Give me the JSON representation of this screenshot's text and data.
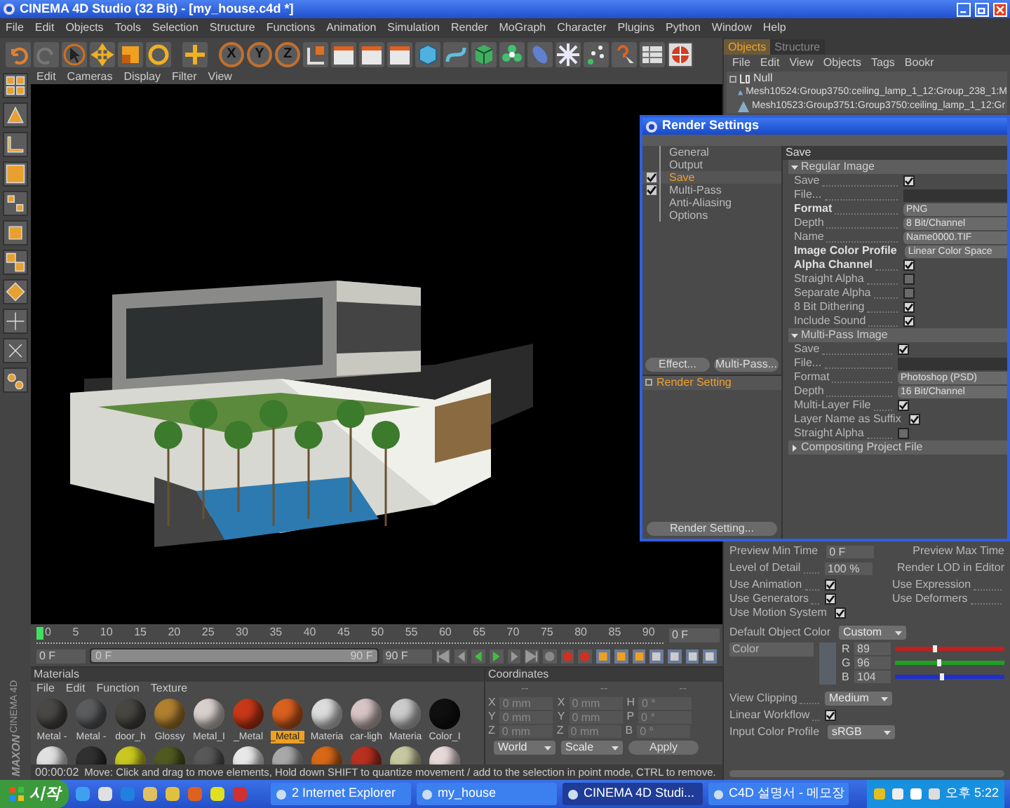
{
  "window": {
    "title": "CINEMA 4D Studio (32 Bit) - [my_house.c4d *]"
  },
  "menu": [
    "File",
    "Edit",
    "Objects",
    "Tools",
    "Selection",
    "Structure",
    "Functions",
    "Animation",
    "Simulation",
    "Render",
    "MoGraph",
    "Character",
    "Plugins",
    "Python",
    "Window",
    "Help"
  ],
  "axis_buttons": [
    "X",
    "Y",
    "Z"
  ],
  "logo": [
    "MAXON",
    "CINEMA 4D"
  ],
  "viewport": {
    "menu": [
      "Edit",
      "Cameras",
      "Display",
      "Filter",
      "View"
    ]
  },
  "timeline": {
    "ticks": [
      "0",
      "5",
      "10",
      "15",
      "20",
      "25",
      "30",
      "35",
      "40",
      "45",
      "50",
      "55",
      "60",
      "65",
      "70",
      "75",
      "80",
      "85",
      "90"
    ],
    "current_frame": "0 F",
    "start": "0 F",
    "range": {
      "start": "0 F",
      "end": "90 F",
      "level": 1
    },
    "end": "90 F"
  },
  "materials": {
    "title": "Materials",
    "menu": [
      "File",
      "Edit",
      "Function",
      "Texture"
    ],
    "items": [
      {
        "label": "Metal -",
        "color": "#4a4844",
        "selected": false
      },
      {
        "label": "Metal -",
        "color": "#5a5c5e",
        "selected": false
      },
      {
        "label": "door_h",
        "color": "#484640",
        "selected": false
      },
      {
        "label": "Glossy",
        "color": "#b08030",
        "selected": false
      },
      {
        "label": "Metal_I",
        "color": "#d8d0cc",
        "selected": false
      },
      {
        "label": "_Metal",
        "color": "#c83818",
        "selected": false
      },
      {
        "label": "_Metal_",
        "color": "#d86020",
        "selected": true
      },
      {
        "label": "Materia",
        "color": "#dcdcdc",
        "selected": false
      },
      {
        "label": "car-ligh",
        "color": "#d8c4c4",
        "selected": false
      },
      {
        "label": "Materia",
        "color": "#cccccc",
        "selected": false
      },
      {
        "label": "Color_I",
        "color": "#101010",
        "selected": false
      }
    ],
    "more_items": [
      {
        "color": "#e0e0e0"
      },
      {
        "color": "#303030"
      },
      {
        "color": "#c8c820"
      },
      {
        "color": "#505a20"
      },
      {
        "color": "#585858"
      },
      {
        "color": "#e8e8e8"
      },
      {
        "color": "#a8a8a8"
      },
      {
        "color": "#d86818"
      },
      {
        "color": "#b83020"
      },
      {
        "color": "#c8c8a0"
      },
      {
        "color": "#e8d8d8"
      }
    ]
  },
  "coordinates": {
    "title": "Coordinates",
    "headers": [
      "--",
      "--",
      "--"
    ],
    "rows": [
      {
        "axis": "X",
        "position": "0 mm",
        "size_axis": "X",
        "size": "0 mm",
        "rot_axis": "H",
        "rotation": "0 °"
      },
      {
        "axis": "Y",
        "position": "0 mm",
        "size_axis": "Y",
        "size": "0 mm",
        "rot_axis": "P",
        "rotation": "0 °"
      },
      {
        "axis": "Z",
        "position": "0 mm",
        "size_axis": "Z",
        "size": "0 mm",
        "rot_axis": "B",
        "rotation": "0 °"
      }
    ],
    "mode": "World",
    "size_mode": "Scale",
    "apply": "Apply"
  },
  "status_bar": {
    "time": "00:00:02",
    "message": "Move: Click and drag to move elements, Hold down SHIFT to quantize movement / add to the selection in point mode, CTRL to remove."
  },
  "objects_panel": {
    "tabs": [
      {
        "label": "Objects",
        "selected": true
      },
      {
        "label": "Structure",
        "selected": false
      }
    ],
    "menu": [
      "File",
      "Edit",
      "View",
      "Objects",
      "Tags",
      "Bookr"
    ],
    "tree": [
      {
        "label": "Null",
        "children": [
          {
            "label": "Mesh10524:Group3750:ceiling_lamp_1_12:Group_238_1:M"
          },
          {
            "label": "Mesh10523:Group3751:Group3750:ceiling_lamp_1_12:Gr"
          }
        ]
      }
    ]
  },
  "attributes": {
    "preview_min": {
      "label": "Preview Min Time",
      "value": "0 F"
    },
    "preview_max": {
      "label": "Preview Max Time"
    },
    "level_of_detail": {
      "label": "Level of Detail",
      "value": "100 %"
    },
    "render_lod": {
      "label": "Render LOD in Editor"
    },
    "left_checks": [
      {
        "label": "Use Animation",
        "checked": true
      },
      {
        "label": "Use Generators",
        "checked": true
      },
      {
        "label": "Use Motion System",
        "checked": true
      }
    ],
    "right_checks": [
      {
        "label": "Use Expression"
      },
      {
        "label": "Use Deformers"
      }
    ],
    "default_color": {
      "label": "Default Object Color",
      "value": "Custom"
    },
    "color": {
      "label": "Color",
      "color": "#596068",
      "channels": [
        {
          "name": "R",
          "value": "89",
          "level": 0.35,
          "color": "#c02020"
        },
        {
          "name": "G",
          "value": "96",
          "level": 0.38,
          "color": "#20a020"
        },
        {
          "name": "B",
          "value": "104",
          "level": 0.41,
          "color": "#2030c8"
        }
      ]
    },
    "view_clipping": {
      "label": "View Clipping",
      "value": "Medium"
    },
    "linear_workflow": {
      "label": "Linear Workflow",
      "checked": true
    },
    "input_profile": {
      "label": "Input Color Profile",
      "value": "sRGB"
    }
  },
  "render_settings": {
    "title": "Render Settings",
    "nav": [
      {
        "label": "General",
        "checked": false,
        "selected": false
      },
      {
        "label": "Output",
        "checked": false,
        "selected": false
      },
      {
        "label": "Save",
        "checked": true,
        "selected": true
      },
      {
        "label": "Multi-Pass",
        "checked": true,
        "selected": false
      },
      {
        "label": "Anti-Aliasing",
        "checked": false,
        "selected": false
      },
      {
        "label": "Options",
        "checked": false,
        "selected": false
      }
    ],
    "buttons": [
      "Effect...",
      "Multi-Pass..."
    ],
    "list": [
      {
        "label": "Render Setting",
        "selected": true
      }
    ],
    "footer_button": "Render Setting...",
    "header": "Save",
    "sections": [
      {
        "title": "Regular Image",
        "expanded": true,
        "rows": [
          {
            "kind": "check",
            "label": "Save",
            "checked": true,
            "bold": false
          },
          {
            "kind": "field",
            "label": "File...",
            "bold": false
          },
          {
            "kind": "dropdown",
            "label": "Format",
            "value": "PNG",
            "bold": true
          },
          {
            "kind": "dropdown",
            "label": "Depth",
            "value": "8 Bit/Channel",
            "bold": false
          },
          {
            "kind": "dropdown",
            "label": "Name",
            "value": "Name0000.TIF",
            "bold": false
          },
          {
            "kind": "dropdown",
            "label": "Image Color Profile",
            "value": "Linear Color Space",
            "bold": true
          },
          {
            "kind": "check",
            "label": "Alpha Channel",
            "checked": true,
            "bold": true
          },
          {
            "kind": "check",
            "label": "Straight Alpha",
            "checked": false,
            "bold": false
          },
          {
            "kind": "check",
            "label": "Separate Alpha",
            "checked": false,
            "bold": false
          },
          {
            "kind": "check",
            "label": "8 Bit Dithering",
            "checked": true,
            "bold": false
          },
          {
            "kind": "check",
            "label": "Include Sound",
            "checked": true,
            "bold": false
          }
        ]
      },
      {
        "title": "Multi-Pass Image",
        "expanded": true,
        "rows": [
          {
            "kind": "check",
            "label": "Save",
            "checked": true,
            "bold": false
          },
          {
            "kind": "field",
            "label": "File...",
            "bold": false
          },
          {
            "kind": "dropdown",
            "label": "Format",
            "value": "Photoshop (PSD)",
            "bold": false
          },
          {
            "kind": "dropdown",
            "label": "Depth",
            "value": "16 Bit/Channel",
            "bold": false
          },
          {
            "kind": "check",
            "label": "Multi-Layer File",
            "checked": true,
            "bold": false
          },
          {
            "kind": "check",
            "label": "Layer Name as Suffix",
            "checked": true,
            "bold": false
          },
          {
            "kind": "check",
            "label": "Straight Alpha",
            "checked": false,
            "bold": false
          }
        ]
      },
      {
        "title": "Compositing Project File",
        "expanded": false
      }
    ]
  },
  "taskbar": {
    "start": "시작",
    "tasks": [
      {
        "label": "2 Internet Explorer",
        "selected": false
      },
      {
        "label": "my_house",
        "selected": false
      },
      {
        "label": "CINEMA 4D Studi...",
        "selected": true
      },
      {
        "label": "C4D 설명서 - 메모장",
        "selected": false
      }
    ],
    "clock": "오후 5:22"
  }
}
